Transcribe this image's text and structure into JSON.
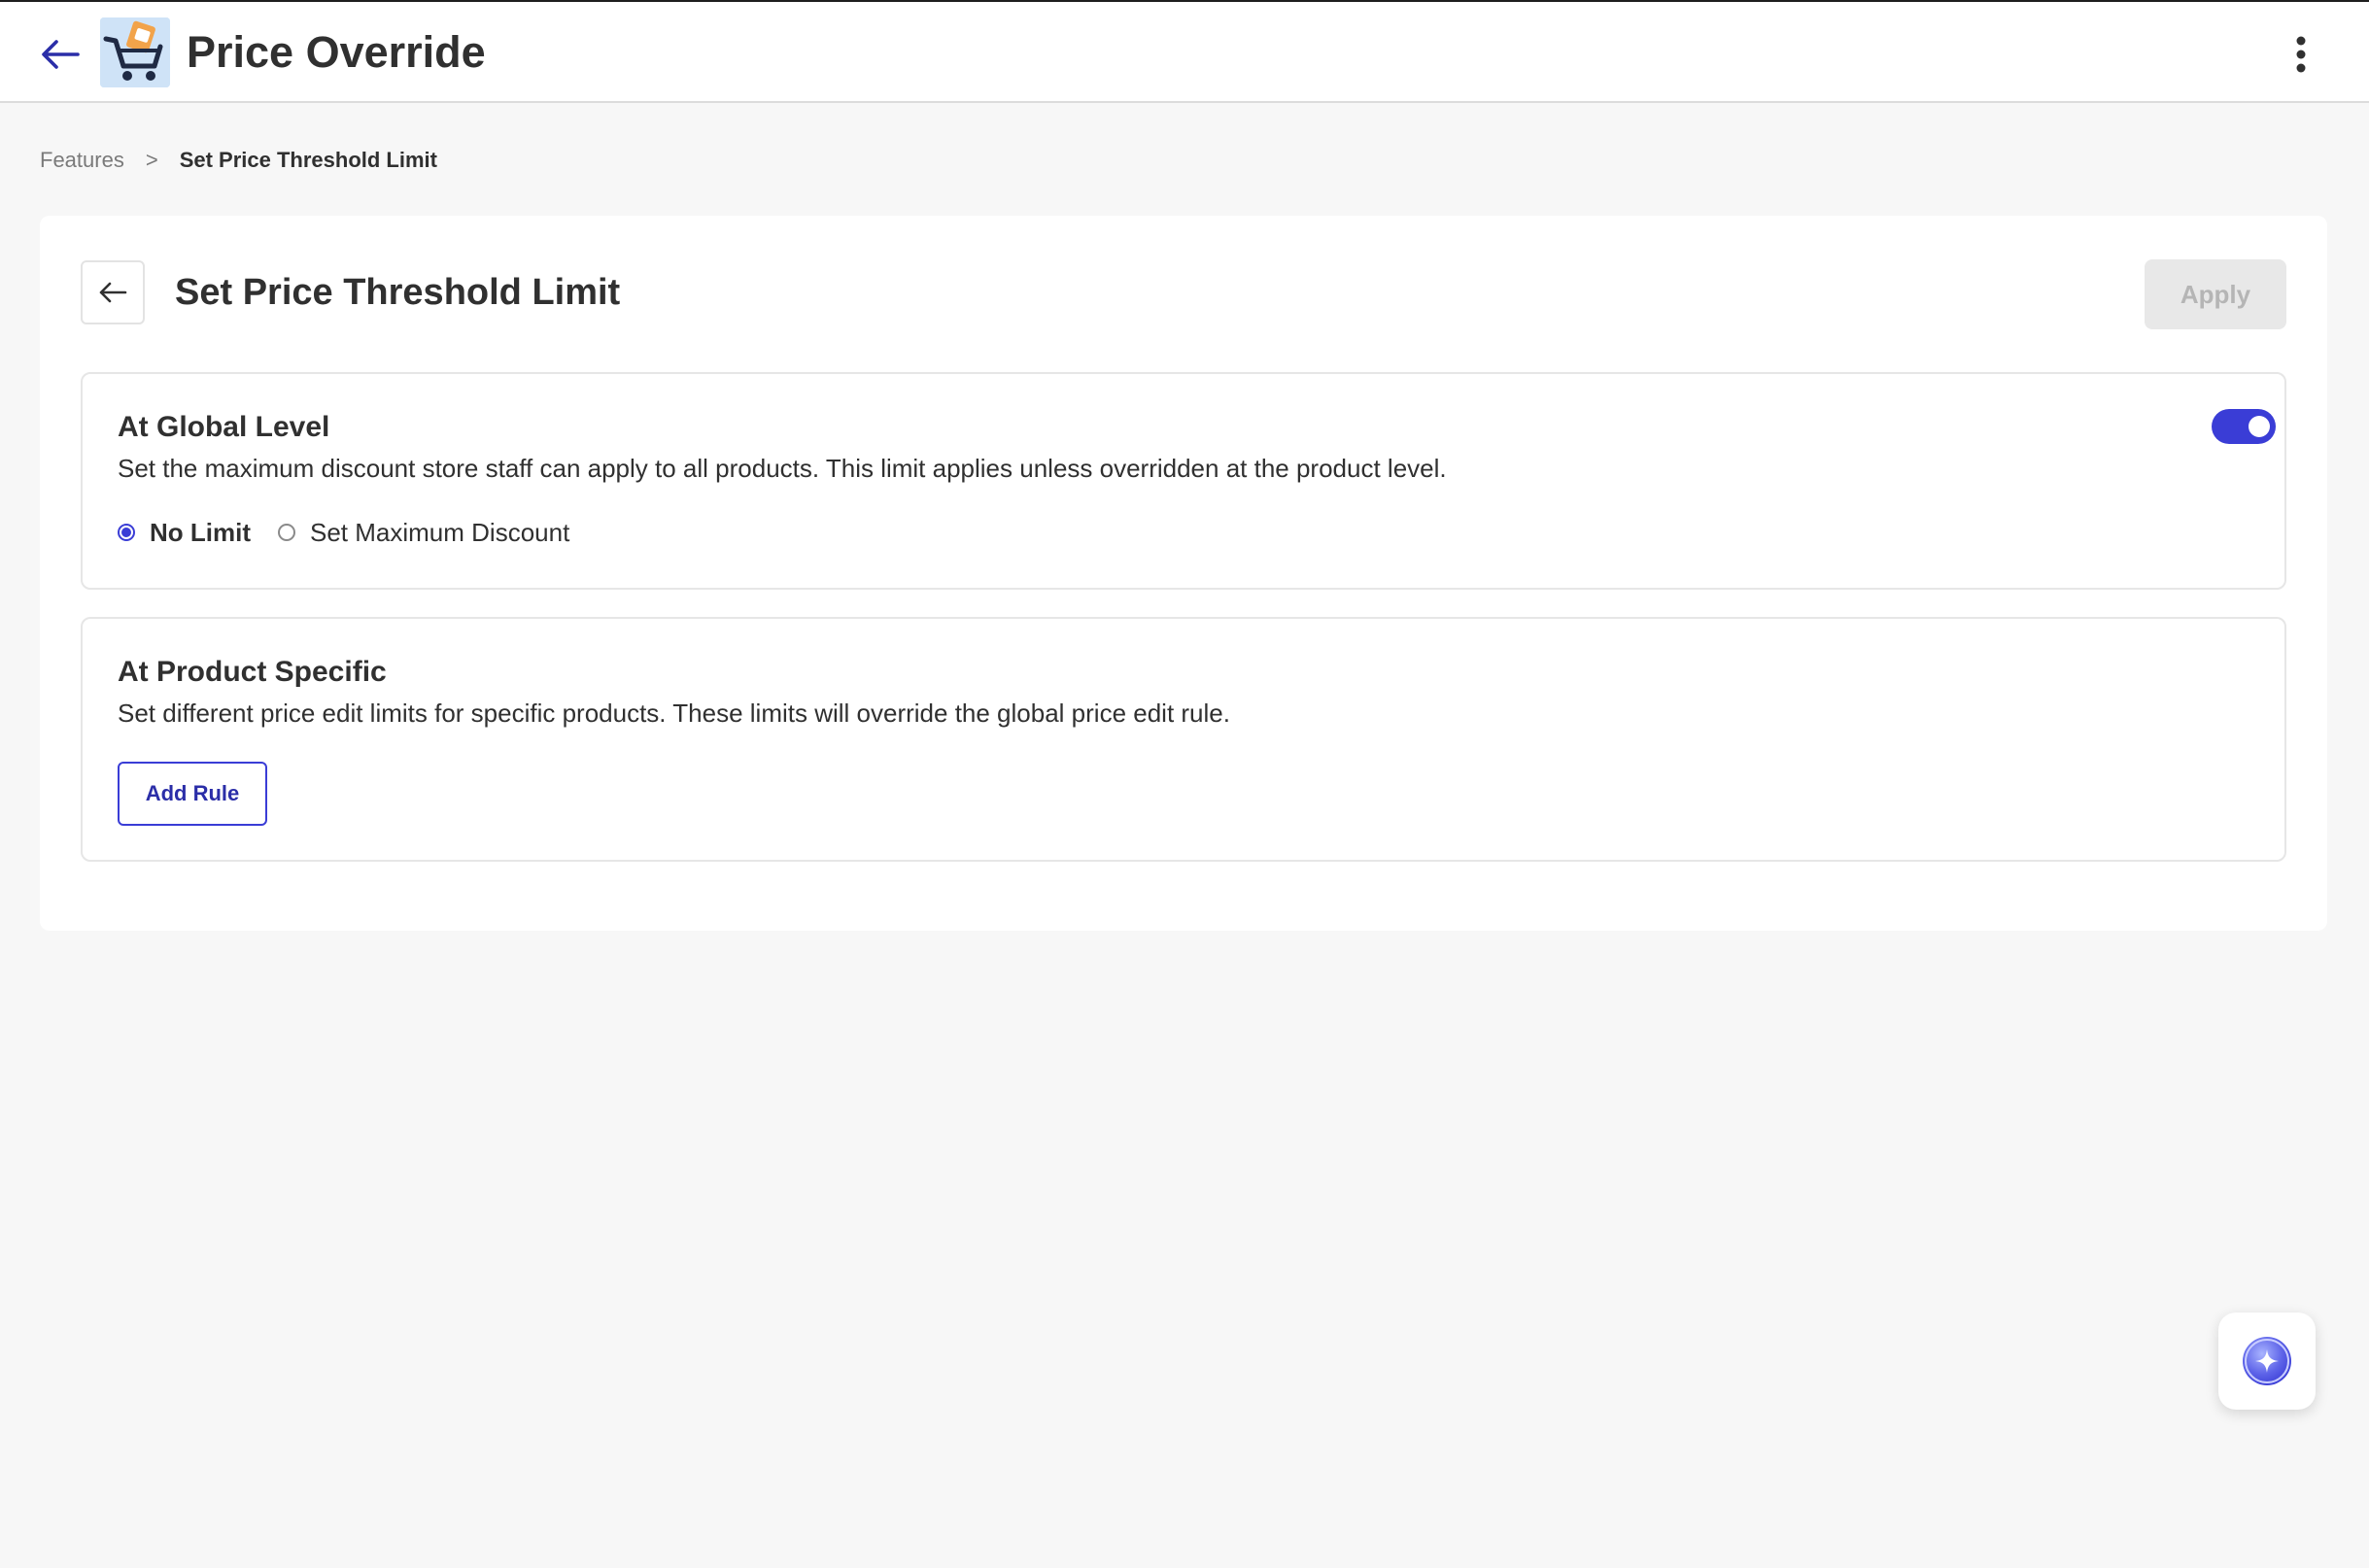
{
  "app": {
    "title": "Price Override",
    "back_icon": "arrow-left-icon",
    "logo_icon": "shopping-cart-logo-icon",
    "more_icon": "kebab-menu-icon"
  },
  "breadcrumb": {
    "parent": "Features",
    "separator": ">",
    "current": "Set Price Threshold Limit"
  },
  "card": {
    "title": "Set Price Threshold Limit",
    "back_icon": "arrow-left-icon",
    "apply_label": "Apply",
    "apply_enabled": false
  },
  "global_level": {
    "title": "At Global Level",
    "description": "Set the maximum discount store staff can apply to all products. This limit applies unless overridden at the product level.",
    "toggle_on": true,
    "options": [
      {
        "label": "No Limit",
        "selected": true
      },
      {
        "label": "Set Maximum Discount",
        "selected": false
      }
    ]
  },
  "product_specific": {
    "title": "At Product Specific",
    "description": "Set different price edit limits for specific products. These limits will override the global price edit rule.",
    "add_rule_label": "Add Rule"
  },
  "assistant": {
    "icon": "sparkle-assistant-icon"
  },
  "colors": {
    "accent": "#3a3dd6",
    "accent_text": "#2b2ea8",
    "page_bg": "#f7f7f7",
    "disabled_bg": "#e8e8e8",
    "disabled_text": "#b5b5b5"
  }
}
